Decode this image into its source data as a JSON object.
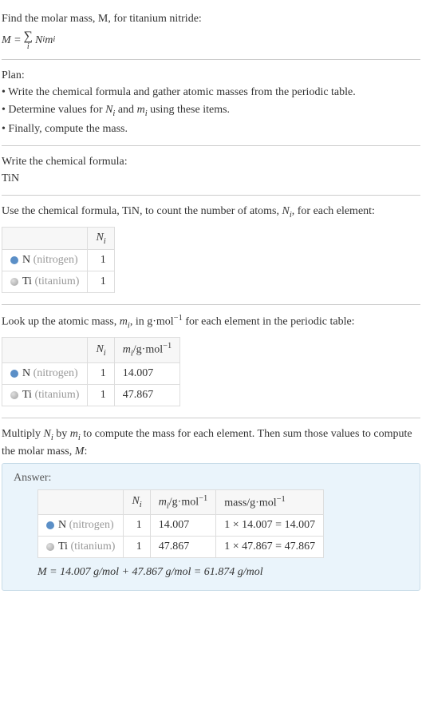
{
  "intro": {
    "prompt": "Find the molar mass, M, for titanium nitride:",
    "formula_lhs": "M = ",
    "formula_sigma_sub": "i",
    "formula_rhs": " N",
    "formula_rhs_sub1": "i",
    "formula_rhs2": "m",
    "formula_rhs_sub2": "i"
  },
  "plan": {
    "heading": "Plan:",
    "bullets": [
      "• Write the chemical formula and gather atomic masses from the periodic table.",
      "• Determine values for Nᵢ and mᵢ using these items.",
      "• Finally, compute the mass."
    ]
  },
  "chem_formula_section": {
    "heading": "Write the chemical formula:",
    "formula": "TiN"
  },
  "count_section": {
    "text_pre": "Use the chemical formula, TiN, to count the number of atoms, ",
    "text_var": "N",
    "text_var_sub": "i",
    "text_post": ", for each element:",
    "header_N": "N",
    "header_N_sub": "i",
    "rows": [
      {
        "dot": "blue",
        "symbol": "N",
        "label": " (nitrogen)",
        "N": "1"
      },
      {
        "dot": "gray",
        "symbol": "Ti",
        "label": " (titanium)",
        "N": "1"
      }
    ]
  },
  "mass_section": {
    "text_pre": "Look up the atomic mass, ",
    "text_var": "m",
    "text_var_sub": "i",
    "text_mid": ", in g·mol",
    "text_sup": "−1",
    "text_post": " for each element in the periodic table:",
    "header_N": "N",
    "header_N_sub": "i",
    "header_m": "m",
    "header_m_sub": "i",
    "header_m_unit": "/g·mol",
    "header_m_sup": "−1",
    "rows": [
      {
        "dot": "blue",
        "symbol": "N",
        "label": " (nitrogen)",
        "N": "1",
        "m": "14.007"
      },
      {
        "dot": "gray",
        "symbol": "Ti",
        "label": " (titanium)",
        "N": "1",
        "m": "47.867"
      }
    ]
  },
  "compute_section": {
    "text1": "Multiply ",
    "var1": "N",
    "var1_sub": "i",
    "text2": " by ",
    "var2": "m",
    "var2_sub": "i",
    "text3": " to compute the mass for each element. Then sum those values to compute the molar mass, ",
    "var3": "M",
    "text4": ":"
  },
  "answer": {
    "label": "Answer:",
    "header_N": "N",
    "header_N_sub": "i",
    "header_m": "m",
    "header_m_sub": "i",
    "header_m_unit": "/g·mol",
    "header_m_sup": "−1",
    "header_mass": "mass/g·mol",
    "header_mass_sup": "−1",
    "rows": [
      {
        "dot": "blue",
        "symbol": "N",
        "label": " (nitrogen)",
        "N": "1",
        "m": "14.007",
        "mass": "1 × 14.007 = 14.007"
      },
      {
        "dot": "gray",
        "symbol": "Ti",
        "label": " (titanium)",
        "N": "1",
        "m": "47.867",
        "mass": "1 × 47.867 = 47.867"
      }
    ],
    "final": "M = 14.007 g/mol + 47.867 g/mol = 61.874 g/mol"
  }
}
